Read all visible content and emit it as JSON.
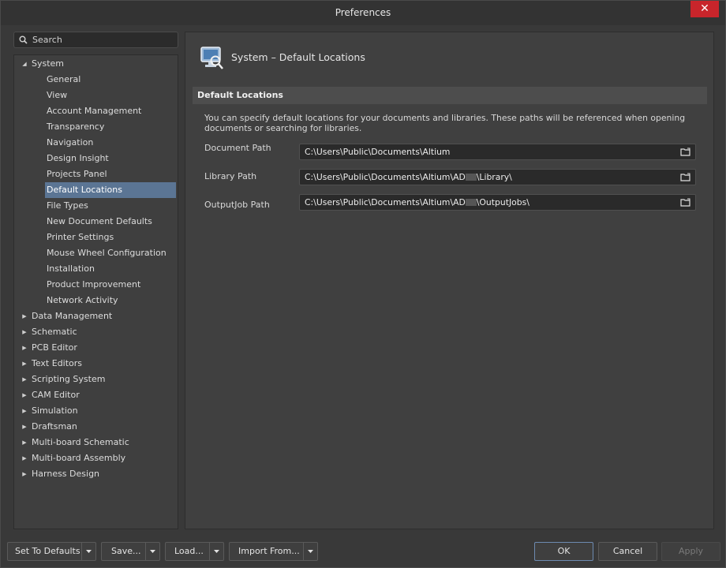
{
  "window": {
    "title": "Preferences",
    "close": "✕"
  },
  "search": {
    "placeholder": "Search"
  },
  "tree": {
    "system": {
      "label": "System",
      "expanded": true
    },
    "system_children": [
      "General",
      "View",
      "Account Management",
      "Transparency",
      "Navigation",
      "Design Insight",
      "Projects Panel",
      "Default Locations",
      "File Types",
      "New Document Defaults",
      "Printer Settings",
      "Mouse Wheel Configuration",
      "Installation",
      "Product Improvement",
      "Network Activity"
    ],
    "selected": "Default Locations",
    "top_level": [
      "Data Management",
      "Schematic",
      "PCB Editor",
      "Text Editors",
      "Scripting System",
      "CAM Editor",
      "Simulation",
      "Draftsman",
      "Multi-board Schematic",
      "Multi-board Assembly",
      "Harness Design"
    ]
  },
  "page": {
    "title": "System – Default Locations",
    "section": "Default Locations",
    "description": "You can specify default locations for your documents and libraries. These paths will be referenced when opening documents or searching for libraries.",
    "fields": [
      {
        "label": "Document Path",
        "value_before": "C:\\Users\\Public\\Documents\\Altium",
        "redacted": false,
        "value_after": ""
      },
      {
        "label": "Library Path",
        "value_before": "C:\\Users\\Public\\Documents\\Altium\\AD",
        "redacted": true,
        "value_after": "\\Library\\"
      },
      {
        "label": "OutputJob Path",
        "value_before": "C:\\Users\\Public\\Documents\\Altium\\AD",
        "redacted": true,
        "value_after": "\\OutputJobs\\"
      }
    ]
  },
  "footer": {
    "set_to_defaults": "Set To Defaults",
    "save": "Save...",
    "load": "Load...",
    "import_from": "Import From...",
    "ok": "OK",
    "cancel": "Cancel",
    "apply": "Apply"
  }
}
